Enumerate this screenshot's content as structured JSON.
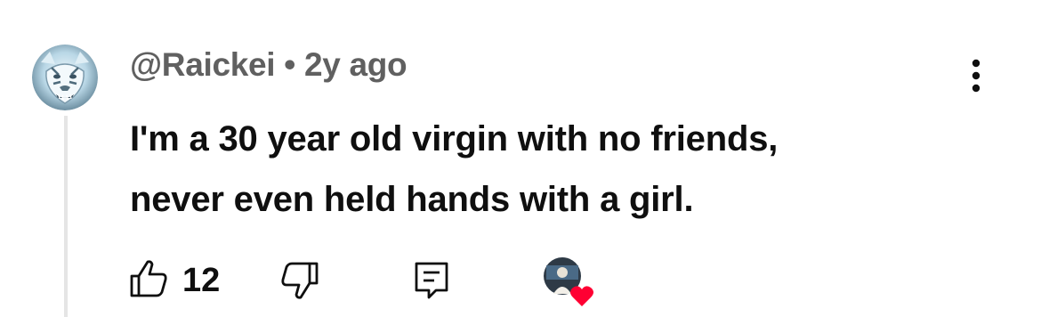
{
  "comment": {
    "author": "@Raickei",
    "separator": "•",
    "time": "2y ago",
    "text_lines": [
      "I'm a 30 year old virgin with no friends,",
      "never even held hands with a girl."
    ]
  },
  "actions": {
    "like_count": "12",
    "like_icon": "thumbs-up-icon",
    "dislike_icon": "thumbs-down-icon",
    "reply_icon": "reply-icon",
    "more_icon": "more-vertical-icon"
  },
  "colors": {
    "text": "#0f0f0f",
    "meta": "#606060",
    "heart": "#ff0033",
    "thread_line": "#e5e5e5"
  }
}
